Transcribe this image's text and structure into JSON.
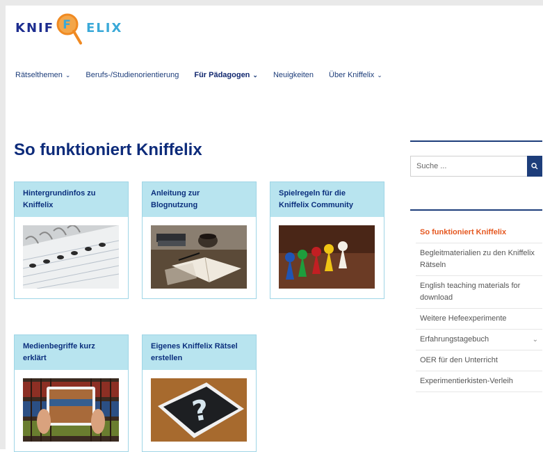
{
  "logo": {
    "part1": "KNIF",
    "part2": "ELIX",
    "letter": "F"
  },
  "nav": [
    {
      "label": "Rätselthemen",
      "has_dropdown": true,
      "active": false
    },
    {
      "label": "Berufs-/Studienorientierung",
      "has_dropdown": false,
      "active": false
    },
    {
      "label": "Für Pädagogen",
      "has_dropdown": true,
      "active": true
    },
    {
      "label": "Neuigkeiten",
      "has_dropdown": false,
      "active": false
    },
    {
      "label": "Über Kniffelix",
      "has_dropdown": true,
      "active": false
    }
  ],
  "page_title": "So funktioniert Kniffelix",
  "cards": [
    {
      "title": "Hintergrundinfos zu Kniffelix",
      "image": "spiral-notebook-image"
    },
    {
      "title": "Anleitung zur Blognutzung",
      "image": "open-book-and-coffee-image"
    },
    {
      "title": "Spielregeln für die Kniffelix Community",
      "image": "colorful-game-pieces-image"
    },
    {
      "title": "Medienbegriffe kurz erklärt",
      "image": "tablet-bookshelf-image"
    },
    {
      "title": "Eigenes Kniffelix Rätsel erstellen",
      "image": "chalkboard-question-image"
    }
  ],
  "search": {
    "placeholder": "Suche ...",
    "icon": "search-icon"
  },
  "sidebar_menu": [
    {
      "label": "So funktioniert Kniffelix",
      "current": true,
      "has_dropdown": false
    },
    {
      "label": "Begleitmaterialien zu den Kniffelix Rätseln",
      "current": false,
      "has_dropdown": false
    },
    {
      "label": "English teaching materials for download",
      "current": false,
      "has_dropdown": false
    },
    {
      "label": "Weitere Hefeexperimente",
      "current": false,
      "has_dropdown": false
    },
    {
      "label": "Erfahrungstagebuch",
      "current": false,
      "has_dropdown": true
    },
    {
      "label": "OER für den Unterricht",
      "current": false,
      "has_dropdown": false
    },
    {
      "label": "Experimentierkisten-Verleih",
      "current": false,
      "has_dropdown": false
    }
  ],
  "colors": {
    "primary": "#0d2b7a",
    "card_head": "#b8e4ef",
    "accent": "#e5571f",
    "logo_orange": "#f08a22"
  }
}
